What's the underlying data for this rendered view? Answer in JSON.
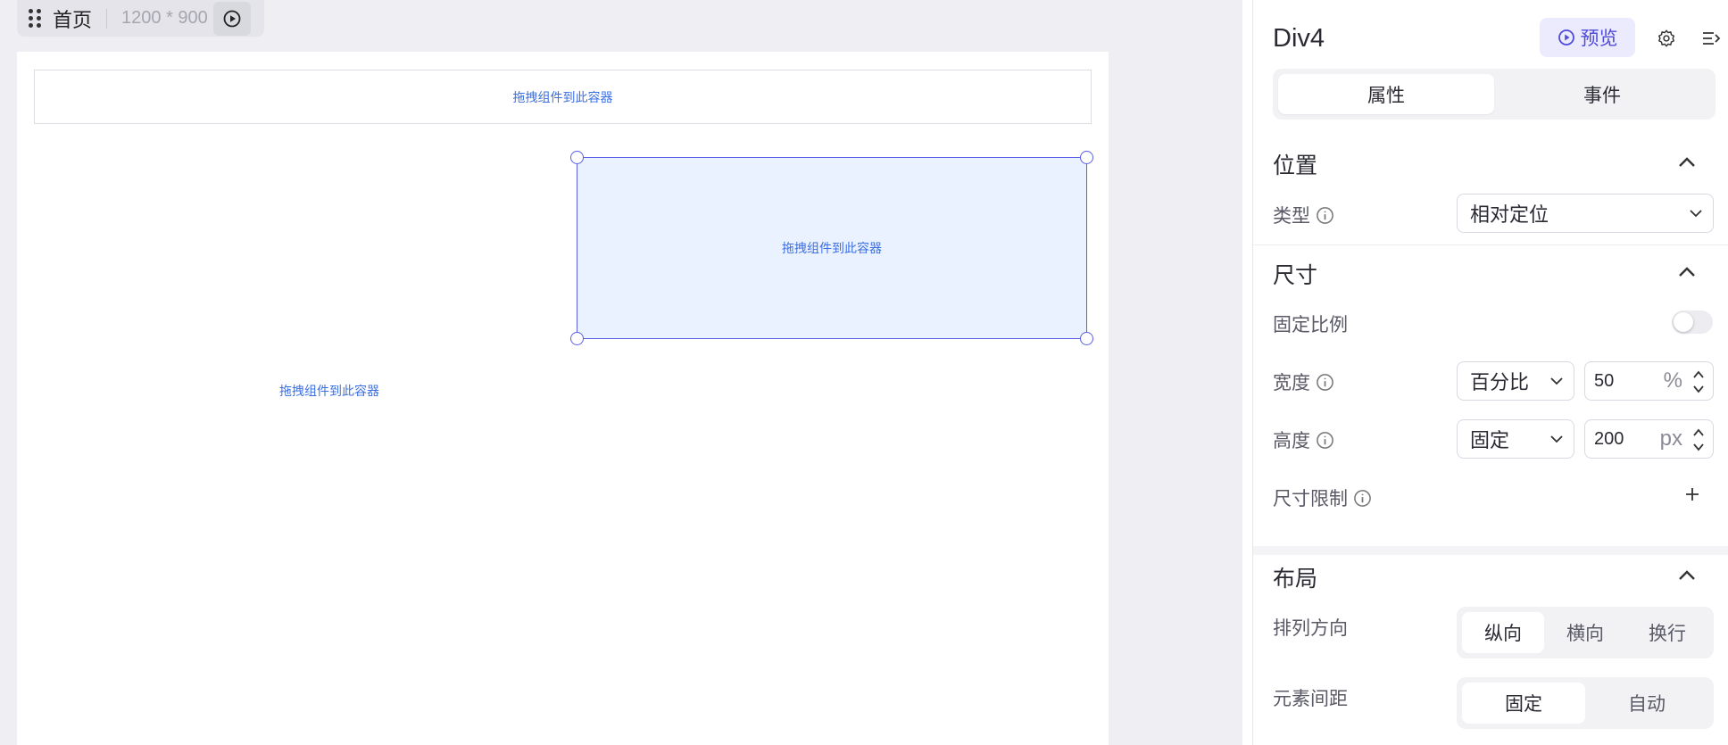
{
  "canvas": {
    "page_name": "首页",
    "page_size": "1200 * 900",
    "containers": {
      "top_placeholder": "拖拽组件到此容器",
      "selected_placeholder": "拖拽组件到此容器",
      "loose_placeholder": "拖拽组件到此容器"
    }
  },
  "panel": {
    "component_name": "Div4",
    "preview_label": "预览",
    "tabs": [
      {
        "label": "属性",
        "active": true
      },
      {
        "label": "事件",
        "active": false
      }
    ],
    "position": {
      "title": "位置",
      "type_label": "类型",
      "type_value": "相对定位"
    },
    "size": {
      "title": "尺寸",
      "lock_ratio_label": "固定比例",
      "lock_ratio_on": false,
      "width_label": "宽度",
      "width_mode": "百分比",
      "width_value": "50",
      "width_unit": "%",
      "height_label": "高度",
      "height_mode": "固定",
      "height_value": "200",
      "height_unit": "px",
      "limit_label": "尺寸限制"
    },
    "layout": {
      "title": "布局",
      "direction_label": "排列方向",
      "direction_options": [
        "纵向",
        "横向",
        "换行"
      ],
      "direction_selected": "纵向",
      "gap_label": "元素间距",
      "gap_options": [
        "固定",
        "自动"
      ],
      "gap_selected": "固定"
    }
  },
  "colors": {
    "accent": "#5b5fe6",
    "placeholder_text": "#3c6fe0",
    "selected_fill": "#ebf2ff",
    "canvas_bg": "#efeff3"
  },
  "icons": [
    "drag-handle-icon",
    "play-circle-icon",
    "gear-icon",
    "collapse-panel-icon",
    "info-icon",
    "chevron-up-icon",
    "chevron-down-icon",
    "stepper-icon",
    "plus-icon"
  ]
}
